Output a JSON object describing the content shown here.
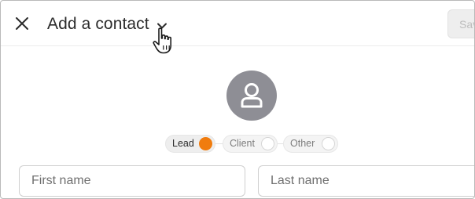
{
  "header": {
    "title": "Add a contact",
    "save_label": "Save",
    "icons": {
      "close": "close-icon",
      "title_dropdown": "chevron-down-icon",
      "cursor": "hand-pointer-cursor-icon",
      "avatar": "person-icon"
    }
  },
  "contact_type": {
    "options": [
      {
        "label": "Lead",
        "selected": true
      },
      {
        "label": "Client",
        "selected": false
      },
      {
        "label": "Other",
        "selected": false
      }
    ],
    "accent_color": "#f07c0e"
  },
  "fields": {
    "first_name": {
      "placeholder": "First name",
      "value": ""
    },
    "last_name": {
      "placeholder": "Last name",
      "value": ""
    }
  },
  "colors": {
    "avatar_bg": "#8e8e95",
    "title_text": "#2c2c2c",
    "save_disabled_bg": "#eeeeee"
  }
}
